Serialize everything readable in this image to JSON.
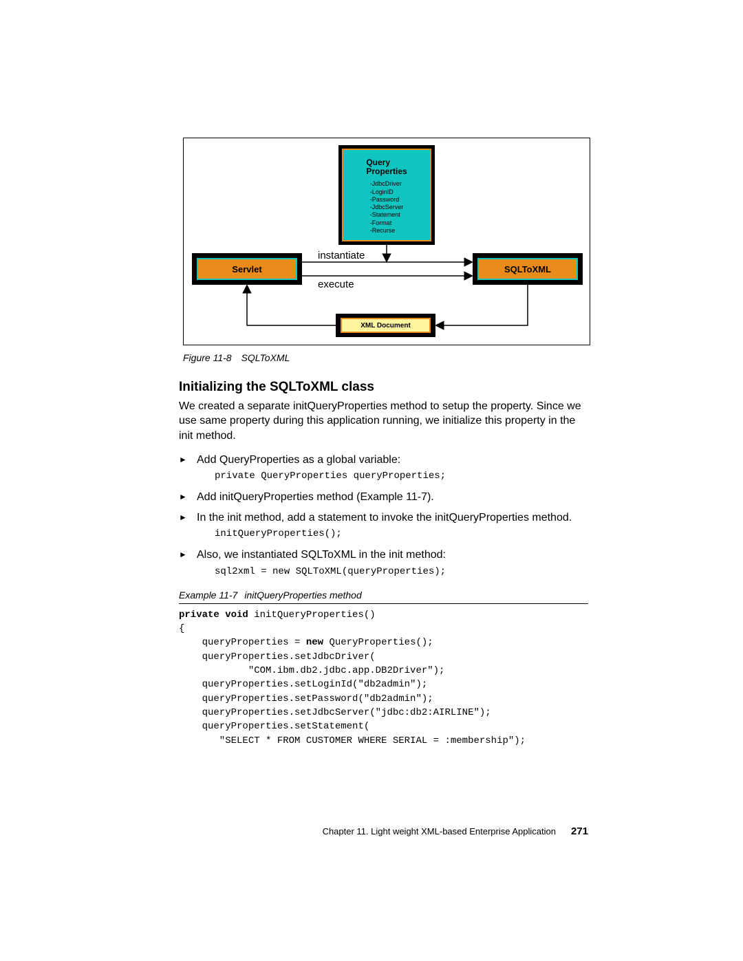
{
  "diagram": {
    "query_properties": {
      "title_l1": "Query",
      "title_l2": "Properties",
      "items": "-JdbcDriver\n-LoginID\n-Password\n-JdbcServer\n-Statement\n-Format\n-Recurse"
    },
    "servlet": "Servlet",
    "sqltoxml": "SQLToXML",
    "xml_document": "XML Document",
    "instantiate": "instantiate",
    "execute": "execute"
  },
  "fig_caption": {
    "num": "Figure 11-8",
    "text": "SQLToXML"
  },
  "heading": "Initializing the SQLToXML class",
  "intro": "We created a separate initQueryProperties method to setup the property. Since we use same property during this application running, we initialize this property in the init method.",
  "bullets": {
    "b1": "Add QueryProperties as a global variable:",
    "c1": "private QueryProperties queryProperties;",
    "b2": "Add initQueryProperties method (Example 11-7).",
    "b3": "In the init method, add a statement to invoke the initQueryProperties method.",
    "c3": "initQueryProperties();",
    "b4": "Also, we instantiated SQLToXML in the init method:",
    "c4": "sql2xml = new SQLToXML(queryProperties);"
  },
  "example_caption": {
    "num": "Example 11-7",
    "text": "initQueryProperties method"
  },
  "code": {
    "l1a": "private void",
    "l1b": " initQueryProperties()",
    "l2": "{",
    "l3a": "    queryProperties = ",
    "l3b": "new",
    "l3c": " QueryProperties();",
    "l4": "    queryProperties.setJdbcDriver(",
    "l5": "            \"COM.ibm.db2.jdbc.app.DB2Driver\");",
    "l6": "    queryProperties.setLoginId(\"db2admin\");",
    "l7": "    queryProperties.setPassword(\"db2admin\");",
    "l8": "    queryProperties.setJdbcServer(\"jdbc:db2:AIRLINE\");",
    "l9": "    queryProperties.setStatement(",
    "l10": "       \"SELECT * FROM CUSTOMER WHERE SERIAL = :membership\");"
  },
  "footer": {
    "chapter": "Chapter 11.  Light weight XML-based Enterprise Application",
    "page": "271"
  }
}
